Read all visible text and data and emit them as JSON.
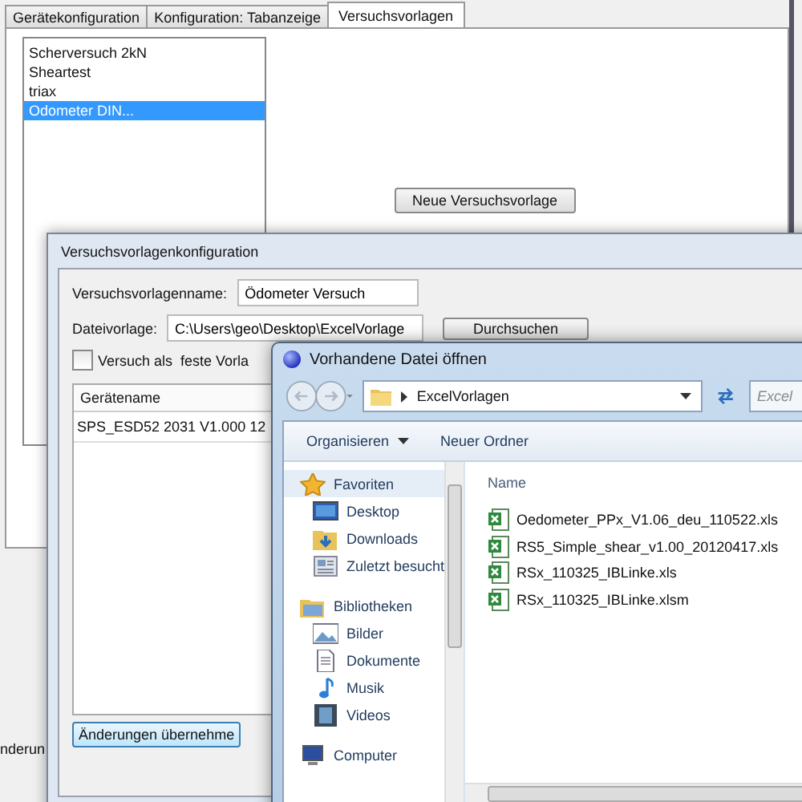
{
  "back_window": {
    "tabs": [
      {
        "label": "Gerätekonfiguration",
        "selected": false
      },
      {
        "label": "Konfiguration: Tabanzeige",
        "selected": false
      },
      {
        "label": "Versuchsvorlagen",
        "selected": true
      }
    ],
    "templates": [
      {
        "label": "Scherversuch 2kN",
        "selected": false
      },
      {
        "label": "Sheartest",
        "selected": false
      },
      {
        "label": "triax",
        "selected": false
      },
      {
        "label": "Odometer DIN...",
        "selected": true
      }
    ],
    "new_button": "Neue Versuchsvorlage",
    "bottom_text": "nderun"
  },
  "config_dialog": {
    "title": "Versuchsvorlagenkonfiguration",
    "name_label": "Versuchsvorlagenname:",
    "name_value": "Ödometer Versuch",
    "file_label": "Dateivorlage:",
    "file_value": "C:\\Users\\geo\\Desktop\\ExcelVorlage",
    "browse_button": "Durchsuchen",
    "fixed_checkbox": {
      "label": "Versuch als  feste Vorla",
      "checked": false
    },
    "devices": {
      "columns": [
        "Gerätename"
      ],
      "rows": [
        "SPS_ESD52 2031 V1.000 12"
      ]
    },
    "apply_button": "Änderungen übernehme"
  },
  "file_dialog": {
    "title": "Vorhandene Datei öffnen",
    "address": "ExcelVorlagen",
    "search_placeholder": "Excel",
    "toolbar": [
      "Organisieren",
      "Neuer Ordner"
    ],
    "nav": [
      {
        "label": "Favoriten",
        "kind": "star",
        "children": [
          {
            "label": "Desktop",
            "kind": "monitor"
          },
          {
            "label": "Downloads",
            "kind": "download"
          },
          {
            "label": "Zuletzt besucht",
            "kind": "recent"
          }
        ]
      },
      {
        "label": "Bibliotheken",
        "kind": "library",
        "children": [
          {
            "label": "Bilder",
            "kind": "image"
          },
          {
            "label": "Dokumente",
            "kind": "document"
          },
          {
            "label": "Musik",
            "kind": "music"
          },
          {
            "label": "Videos",
            "kind": "video"
          }
        ]
      },
      {
        "label": "Computer",
        "kind": "computer"
      }
    ],
    "column": "Name",
    "files": [
      "Oedometer_PPx_V1.06_deu_110522.xls",
      "RS5_Simple_shear_v1.00_20120417.xls",
      "RSx_110325_IBLinke.xls",
      "RSx_110325_IBLinke.xlsm"
    ]
  }
}
